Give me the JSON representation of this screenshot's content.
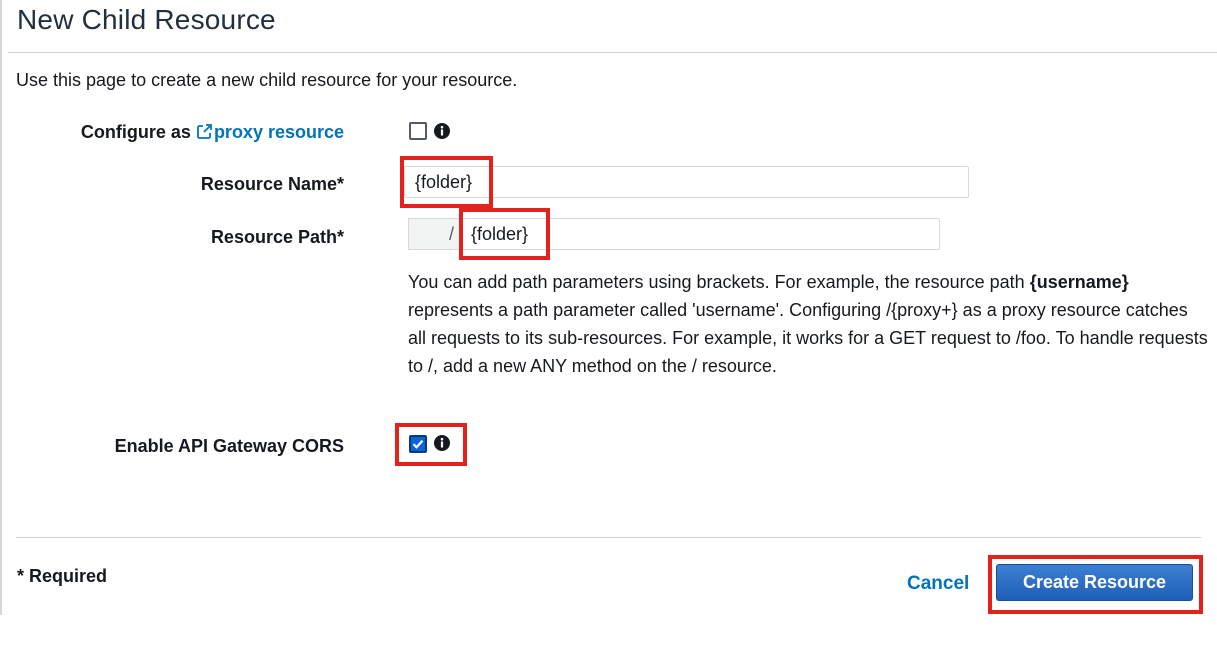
{
  "page": {
    "title": "New Child Resource",
    "intro": "Use this page to create a new child resource for your resource."
  },
  "form": {
    "proxy": {
      "label_prefix": "Configure as",
      "link_text": "proxy resource",
      "checked": false
    },
    "resource_name": {
      "label": "Resource Name*",
      "value": "{folder}"
    },
    "resource_path": {
      "label": "Resource Path*",
      "prefix": "/",
      "value": "{folder}"
    },
    "help": {
      "part1": "You can add path parameters using brackets. For example, the resource path ",
      "bold": "{username}",
      "part2": " represents a path parameter called 'username'. Configuring /{proxy+} as a proxy resource catches all requests to its sub-resources. For example, it works for a GET request to /foo. To handle requests to /, add a new ANY method on the / resource."
    },
    "cors": {
      "label": "Enable API Gateway CORS",
      "checked": true
    }
  },
  "footer": {
    "required_note": "* Required",
    "cancel_label": "Cancel",
    "create_label": "Create Resource"
  },
  "colors": {
    "link": "#0073bb",
    "primary_button": "#1f5fb8",
    "highlight": "#e3221b"
  }
}
